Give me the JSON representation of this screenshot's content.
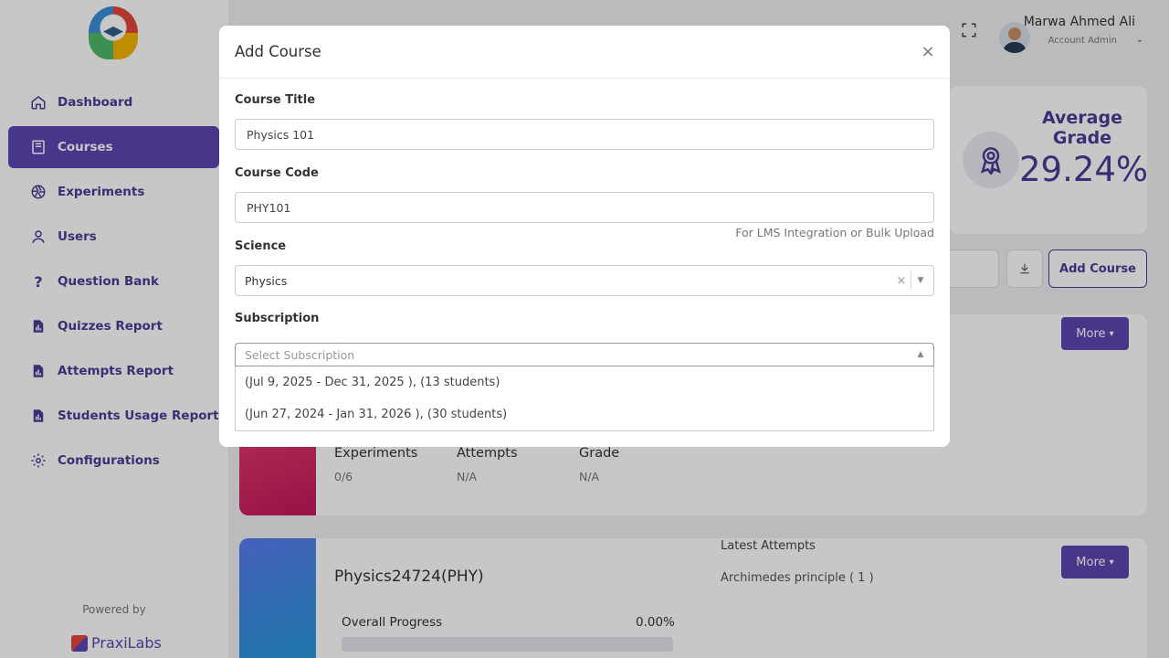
{
  "sidebar": {
    "items": [
      {
        "label": "Dashboard",
        "icon": "home-icon"
      },
      {
        "label": "Courses",
        "icon": "book-icon",
        "active": true
      },
      {
        "label": "Experiments",
        "icon": "aperture-icon"
      },
      {
        "label": "Users",
        "icon": "user-icon"
      },
      {
        "label": "Question Bank",
        "icon": "question-icon"
      },
      {
        "label": "Quizzes Report",
        "icon": "report-icon"
      },
      {
        "label": "Attempts Report",
        "icon": "report-icon"
      },
      {
        "label": "Students Usage Report",
        "icon": "report-icon"
      },
      {
        "label": "Configurations",
        "icon": "gear-icon"
      }
    ],
    "powered_by": "Powered by",
    "brand": "PraxiLabs"
  },
  "topbar": {
    "user_name": "Marwa Ahmed Ali",
    "user_role": "Account Admin"
  },
  "stats": {
    "label": "Average Grade",
    "value": "29.24%"
  },
  "toolbar": {
    "add_course_label": "Add Course"
  },
  "courses": [
    {
      "more_label": "More",
      "stats": [
        {
          "label": "Experiments",
          "value": "0/6"
        },
        {
          "label": "Attempts",
          "value": "N/A"
        },
        {
          "label": "Grade",
          "value": "N/A"
        }
      ]
    },
    {
      "name": "Physics24724(PHY)",
      "more_label": "More",
      "latest_label": "Latest Attempts",
      "latest_item": "Archimedes principle ( 1 )",
      "progress_label": "Overall Progress",
      "progress_value": "0.00%",
      "progress": 0.0
    }
  ],
  "modal": {
    "title": "Add Course",
    "course_title_label": "Course Title",
    "course_title_value": "Physics 101",
    "course_code_label": "Course Code",
    "course_code_value": "PHY101",
    "course_code_hint": "For LMS Integration or Bulk Upload",
    "science_label": "Science",
    "science_value": "Physics",
    "subscription_label": "Subscription",
    "subscription_placeholder": "Select Subscription",
    "subscription_options": [
      "(Jul 9, 2025 - Dec 31, 2025 ), (13 students)",
      "(Jun 27, 2024 - Jan 31, 2026 ), (30 students)"
    ]
  },
  "colors": {
    "brand": "#5b46b0",
    "brand_dark": "#4b3b95"
  }
}
